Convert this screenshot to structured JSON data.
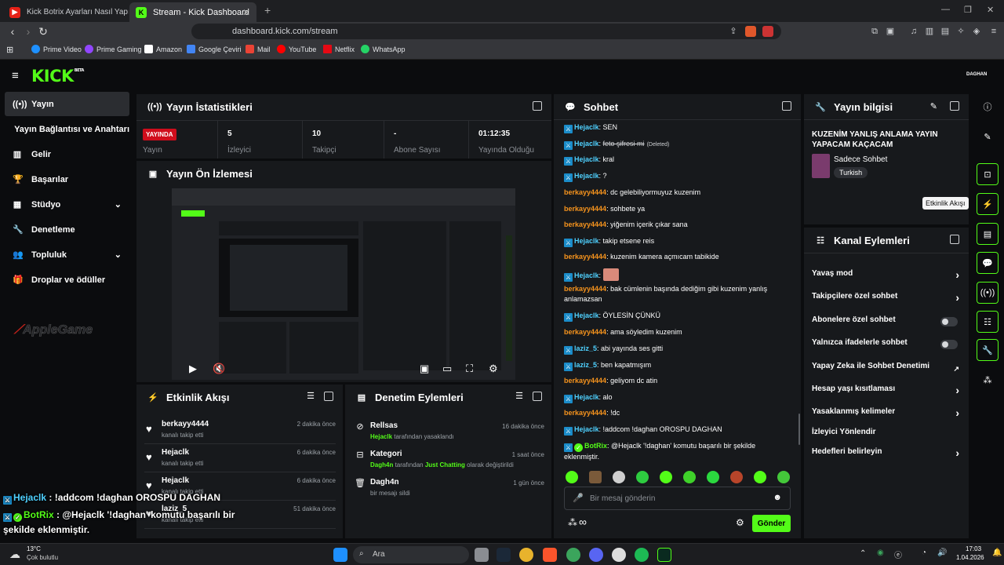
{
  "browser": {
    "tabs": [
      {
        "title": "Kick Botrix Ayarları Nasıl Yapılır? Takip",
        "active": false
      },
      {
        "title": "Stream - Kick Dashboard",
        "active": true
      }
    ],
    "url": "dashboard.kick.com/stream",
    "bookmarks": [
      "Prime Video",
      "Prime Gaming",
      "Amazon",
      "Google Çeviri",
      "Mail",
      "YouTube",
      "Netflix",
      "WhatsApp"
    ]
  },
  "header": {
    "logo": "KICK",
    "beta": "BETA",
    "user": "DAGHAN"
  },
  "sidebar": {
    "items": [
      {
        "label": "Yayın",
        "icon": "broadcast-icon",
        "active": true
      },
      {
        "label": "Yayın Bağlantısı ve Anahtarı",
        "icon": "",
        "active": false
      },
      {
        "label": "Gelir",
        "icon": "chart-icon",
        "active": false
      },
      {
        "label": "Başarılar",
        "icon": "trophy-icon",
        "active": false
      },
      {
        "label": "Stüdyo",
        "icon": "studio-icon",
        "active": false
      },
      {
        "label": "Denetleme",
        "icon": "wrench-icon",
        "active": false
      },
      {
        "label": "Topluluk",
        "icon": "people-icon",
        "active": false
      },
      {
        "label": "Droplar ve ödüller",
        "icon": "gift-icon",
        "active": false
      }
    ],
    "partner_logo": "AppleGame"
  },
  "stats": {
    "title": "Yayın İstatistikleri",
    "live_badge": "YAYINDA",
    "cells": [
      {
        "value": "",
        "label": "Yayın"
      },
      {
        "value": "5",
        "label": "İzleyici"
      },
      {
        "value": "10",
        "label": "Takipçi"
      },
      {
        "value": "-",
        "label": "Abone Sayısı"
      },
      {
        "value": "01:12:35",
        "label": "Yayında Olduğu"
      }
    ]
  },
  "preview": {
    "title": "Yayın Ön İzlemesi"
  },
  "activity": {
    "title": "Etkinlik Akışı",
    "items": [
      {
        "name": "berkayy4444",
        "sub": "kanalı takip etti",
        "time": "2 dakika önce"
      },
      {
        "name": "Hejaclk",
        "sub": "kanalı takip etti",
        "time": "6 dakika önce"
      },
      {
        "name": "Hejaclk",
        "sub": "kanalı takip etti",
        "time": "6 dakika önce"
      },
      {
        "name": "laziz_5",
        "sub": "kanalı takip etti",
        "time": "51 dakika önce"
      }
    ]
  },
  "moderation": {
    "title": "Denetim Eylemleri",
    "items": [
      {
        "name": "Rellsas",
        "actor": "Hejaclk",
        "sub": " tarafından yasaklandı",
        "time": "16 dakika önce",
        "icon": "ban-icon"
      },
      {
        "name": "Kategori",
        "actor": "Dagh4n",
        "sub": " tarafından ",
        "category": "Just Chatting",
        "sub2": " olarak değiştirildi",
        "time": "1 saat önce",
        "icon": "category-icon"
      },
      {
        "name": "Dagh4n",
        "actor": "",
        "sub": "bir mesajı sildi",
        "time": "1 gün önce",
        "icon": "trash-icon"
      }
    ]
  },
  "chat": {
    "title": "Sohbet",
    "messages": [
      {
        "user": "Hejaclk",
        "color": "blue",
        "badge": true,
        "text": ": SEN"
      },
      {
        "user": "Hejaclk",
        "color": "blue",
        "badge": true,
        "text": ": ",
        "deleted_text": "feto şifresi mi",
        "deleted_tag": "(Deleted)"
      },
      {
        "user": "Hejaclk",
        "color": "blue",
        "badge": true,
        "text": ": kral"
      },
      {
        "user": "Hejaclk",
        "color": "blue",
        "badge": true,
        "text": ": ?"
      },
      {
        "user": "berkayy4444",
        "color": "orange",
        "badge": false,
        "text": ": dc gelebiliyormuyuz kuzenim"
      },
      {
        "user": "berkayy4444",
        "color": "orange",
        "badge": false,
        "text": ": sohbete ya"
      },
      {
        "user": "berkayy4444",
        "color": "orange",
        "badge": false,
        "text": ": yiğenim içerik çıkar sana"
      },
      {
        "user": "Hejaclk",
        "color": "blue",
        "badge": true,
        "text": ": takip etsene reis"
      },
      {
        "user": "berkayy4444",
        "color": "orange",
        "badge": false,
        "text": ": kuzenim kamera açmıcam tabikide"
      },
      {
        "user": "Hejaclk",
        "color": "blue",
        "badge": true,
        "text": ": "
      },
      {
        "user": "berkayy4444",
        "color": "orange",
        "badge": false,
        "text": ": bak cümlenin başında dediğim gibi kuzenim yanlış anlamazsan"
      },
      {
        "user": "Hejaclk",
        "color": "blue",
        "badge": true,
        "text": ": ÖYLESİN ÇÜNKÜ"
      },
      {
        "user": "berkayy4444",
        "color": "orange",
        "badge": false,
        "text": ": ama söyledim kuzenim"
      },
      {
        "user": "laziz_5",
        "color": "blue",
        "badge": true,
        "text": ": abi yayında ses gitti"
      },
      {
        "user": "laziz_5",
        "color": "blue",
        "badge": true,
        "text": ": ben kapatmışım"
      },
      {
        "user": "berkayy4444",
        "color": "orange",
        "badge": false,
        "text": ": geliyom dc atin"
      },
      {
        "user": "Hejaclk",
        "color": "blue",
        "badge": true,
        "text": ": alo"
      },
      {
        "user": "berkayy4444",
        "color": "orange",
        "badge": false,
        "text": ": !dc"
      },
      {
        "user": "Hejaclk",
        "color": "blue",
        "badge": true,
        "text": ": !addcom !daghan OROSPU DAGHAN"
      },
      {
        "user": "BotRix",
        "color": "green",
        "badge": true,
        "text": ": @Hejaclk '!daghan' komutu başarılı bir şekilde eklenmiştir."
      }
    ],
    "input_placeholder": "Bir mesaj gönderin",
    "send_label": "Gönder"
  },
  "stream_info": {
    "title": "Yayın bilgisi",
    "stream_title": "KUZENİM YANLIŞ ANLAMA YAYIN YAPACAM KAÇACAM",
    "category": "Sadece Sohbet",
    "language": "Turkish"
  },
  "channel_actions": {
    "title": "Kanal Eylemleri",
    "items": [
      {
        "label": "Yavaş mod",
        "control": "chevron"
      },
      {
        "label": "Takipçilere özel sohbet",
        "control": "chevron"
      },
      {
        "label": "Abonelere özel sohbet",
        "control": "toggle"
      },
      {
        "label": "Yalnızca ifadelerle sohbet",
        "control": "toggle"
      },
      {
        "label": "Yapay Zeka ile Sohbet Denetimi",
        "control": "external"
      },
      {
        "label": "Hesap yaşı kısıtlaması",
        "control": "chevron"
      },
      {
        "label": "Yasaklanmış kelimeler",
        "control": "chevron"
      },
      {
        "label": "İzleyici Yönlendir",
        "control": "none"
      },
      {
        "label": "Hedefleri belirleyin",
        "control": "chevron"
      }
    ]
  },
  "right_rail": {
    "tooltip": "Etkinlik Akışı"
  },
  "overlay": {
    "line1_user": "Hejaclk",
    "line1_text": " : !addcom !daghan OROSPU DAGHAN",
    "line2_user": "BotRix",
    "line2_text": " : @Hejaclk '!daghan' komutu başarılı bir",
    "line3_text": "şekilde eklenmiştir."
  },
  "taskbar": {
    "weather_temp": "13°C",
    "weather_desc": "Çok bulutlu",
    "search_placeholder": "Ara",
    "time": "17:03",
    "date": "1.04.2026"
  },
  "colors": {
    "brand": "#53fc18",
    "live": "#d00d1c",
    "bg": "#0b0c0e",
    "panel": "#17191c"
  }
}
